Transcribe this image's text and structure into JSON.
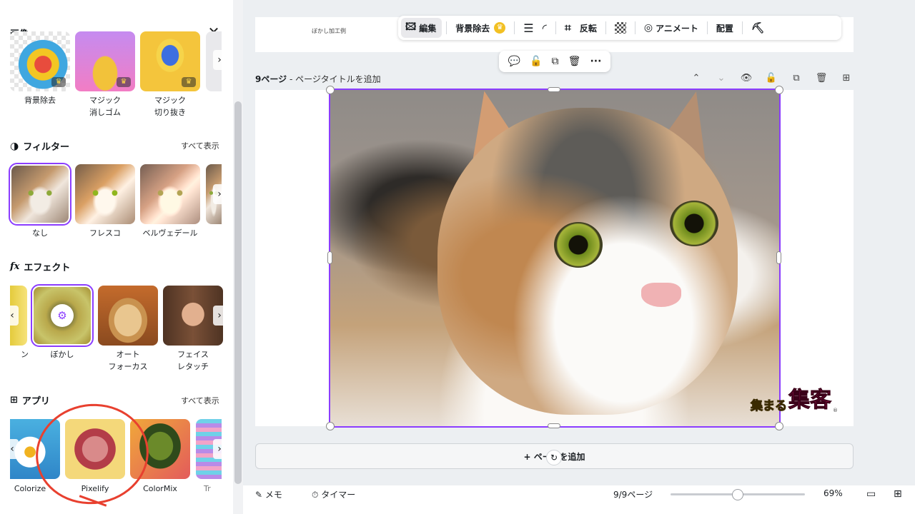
{
  "panel": {
    "title": "画像",
    "close_glyph": "✕",
    "top_tools": [
      {
        "label": "背景除去"
      },
      {
        "label": "マジック\n消しゴム"
      },
      {
        "label": "マジック\n切り抜き"
      }
    ],
    "filters": {
      "heading": "フィルター",
      "see_all": "すべて表示",
      "items": [
        {
          "label": "なし",
          "selected": true
        },
        {
          "label": "フレスコ",
          "selected": false
        },
        {
          "label": "ベルヴェデール",
          "selected": false
        }
      ]
    },
    "effects": {
      "heading": "エフェクト",
      "heading_prefix": "fx",
      "partial_label": "ン",
      "items": [
        {
          "label": "ぼかし",
          "selected": true
        },
        {
          "label": "オート\nフォーカス",
          "selected": false
        },
        {
          "label": "フェイス\nレタッチ",
          "selected": false
        }
      ]
    },
    "apps": {
      "heading": "アプリ",
      "see_all": "すべて表示",
      "items": [
        {
          "label": "Colorize"
        },
        {
          "label": "Pixelify"
        },
        {
          "label": "ColorMix"
        },
        {
          "label": "Tr"
        }
      ]
    }
  },
  "toolbar": {
    "edit": "編集",
    "bg_remove": "背景除去",
    "flip": "反転",
    "animate": "アニメート",
    "position": "配置"
  },
  "prev_page_text": "ぼかし加工例",
  "page": {
    "number_label": "9ページ",
    "title_placeholder": " - ページタイトルを追加"
  },
  "brand": {
    "part1": "集まる",
    "part2": "集客",
    "mark": "®"
  },
  "add_page_label": "+ ページを追加",
  "bottom": {
    "notes": "メモ",
    "timer": "タイマー",
    "page_count": "9/9ページ",
    "zoom": "69%",
    "zoom_fraction": 0.5
  },
  "colors": {
    "accent": "#8b3dff",
    "highlight": "#e8402f"
  }
}
